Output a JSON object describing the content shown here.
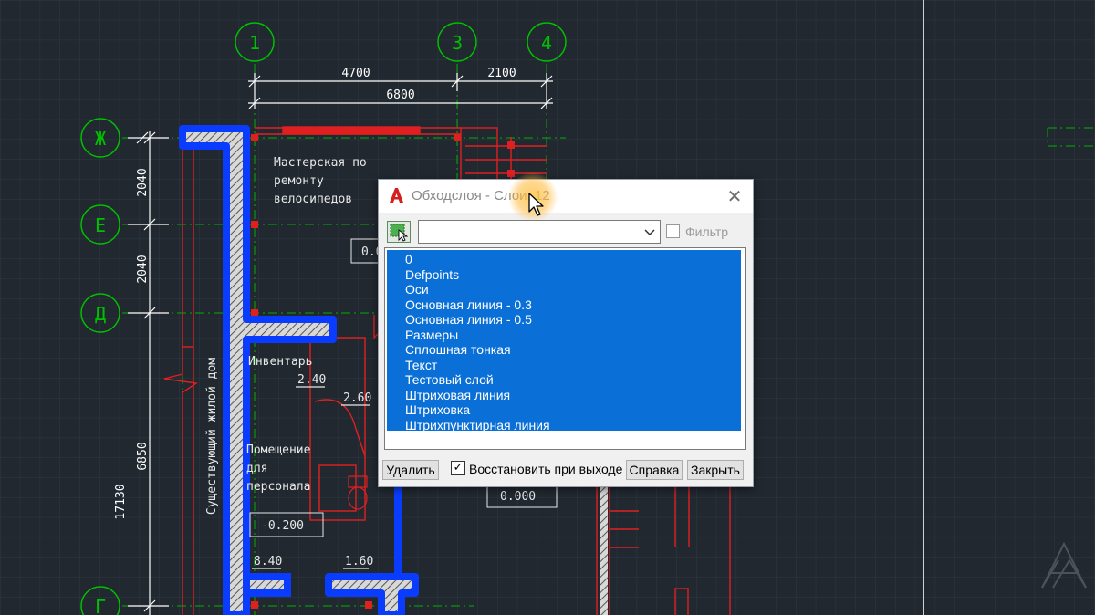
{
  "drawing": {
    "grid_bubbles": [
      {
        "label": "1"
      },
      {
        "label": "3"
      },
      {
        "label": "4"
      },
      {
        "label": "Ж"
      },
      {
        "label": "Е"
      },
      {
        "label": "Д"
      },
      {
        "label": "Г"
      }
    ],
    "dimensions": {
      "top_left": "4700",
      "top_right": "2100",
      "top_total": "6800",
      "left_1": "2040",
      "left_2": "2040",
      "left_3": "6850",
      "left_total": "17130"
    },
    "rooms": {
      "workshop_line1": "Мастерская по",
      "workshop_line2": "ремонту",
      "workshop_line3": "велосипедов",
      "inventory": "Инвентарь",
      "staff_line1": "Помещение",
      "staff_line2": "для",
      "staff_line3": "персонала",
      "existing_house": "Существующий жилой дом"
    },
    "levels": {
      "workshop_level": "0.0",
      "area_inventory": "2.40",
      "area_260": "2.60",
      "level_000": "0.000",
      "level_staff": "-0.200",
      "area_840": "8.40",
      "area_160": "1.60"
    },
    "colors": {
      "background": "#212830",
      "grid": "#2d3540",
      "axis_green": "#00c000",
      "wall_red": "#e02020",
      "selected_blue": "#0a3cff",
      "dimension_white": "#ffffff"
    }
  },
  "dialog": {
    "title": "Обходслоя - Слои: 12",
    "filter_label": "Фильтр",
    "combo_value": "",
    "layers": [
      "0",
      "Defpoints",
      "Оси",
      "Основная линия - 0.3",
      "Основная линия - 0.5",
      "Размеры",
      "Сплошная тонкая",
      "Текст",
      "Тестовый слой",
      "Штриховая линия",
      "Штриховка",
      "Штрихпунктирная линия"
    ],
    "delete_label": "Удалить",
    "restore_label": "Восстановить при выходе",
    "restore_checked": true,
    "help_label": "Справка",
    "close_label": "Закрыть",
    "icons": {
      "app": "autocad-icon",
      "close": "close-icon",
      "select": "select-objects-icon",
      "dropdown": "chevron-down-icon",
      "cursor": "mouse-pointer-icon"
    }
  }
}
